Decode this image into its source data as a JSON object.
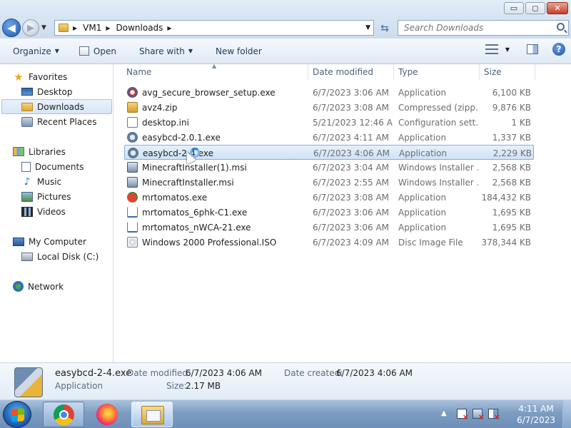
{
  "window": {
    "minimize": "▭",
    "maximize": "◻",
    "close": "✕"
  },
  "address": {
    "back": "◀",
    "forward": "▶",
    "crumbs": [
      "VM1",
      "Downloads"
    ],
    "refresh": "⇆",
    "search_placeholder": "Search Downloads"
  },
  "toolbar": {
    "organize": "Organize",
    "open": "Open",
    "share": "Share with",
    "new_folder": "New folder"
  },
  "nav": {
    "favorites": "Favorites",
    "desktop": "Desktop",
    "downloads": "Downloads",
    "recent": "Recent Places",
    "libraries": "Libraries",
    "documents": "Documents",
    "music": "Music",
    "pictures": "Pictures",
    "videos": "Videos",
    "computer": "My Computer",
    "local_disk": "Local Disk (C:)",
    "network": "Network"
  },
  "columns": {
    "name": "Name",
    "date": "Date modified",
    "type": "Type",
    "size": "Size"
  },
  "files": [
    {
      "icon": "avg-installer-icon",
      "name": "avg_secure_browser_setup.exe",
      "date": "6/7/2023 3:06 AM",
      "type": "Application",
      "size": "6,100 KB"
    },
    {
      "icon": "zip-icon",
      "name": "avz4.zip",
      "date": "6/7/2023 3:08 AM",
      "type": "Compressed (zipp...",
      "size": "9,876 KB"
    },
    {
      "icon": "ini-file-icon",
      "name": "desktop.ini",
      "date": "5/21/2023 12:46 AM",
      "type": "Configuration sett...",
      "size": "1 KB"
    },
    {
      "icon": "easybcd-icon",
      "name": "easybcd-2.0.1.exe",
      "date": "6/7/2023 4:11 AM",
      "type": "Application",
      "size": "1,337 KB"
    },
    {
      "icon": "easybcd-icon",
      "name": "easybcd-2-4.exe",
      "date": "6/7/2023 4:06 AM",
      "type": "Application",
      "size": "2,229 KB",
      "selected": true
    },
    {
      "icon": "msi-icon",
      "name": "MinecraftInstaller(1).msi",
      "date": "6/7/2023 3:04 AM",
      "type": "Windows Installer ...",
      "size": "2,568 KB"
    },
    {
      "icon": "msi-icon",
      "name": "MinecraftInstaller.msi",
      "date": "6/7/2023 2:55 AM",
      "type": "Windows Installer ...",
      "size": "2,568 KB"
    },
    {
      "icon": "tomato-icon",
      "name": "mrtomatos.exe",
      "date": "6/7/2023 3:08 AM",
      "type": "Application",
      "size": "184,432 KB"
    },
    {
      "icon": "download-file-icon",
      "name": "mrtomatos_6phk-C1.exe",
      "date": "6/7/2023 3:06 AM",
      "type": "Application",
      "size": "1,695 KB"
    },
    {
      "icon": "download-file-icon",
      "name": "mrtomatos_nWCA-21.exe",
      "date": "6/7/2023 3:06 AM",
      "type": "Application",
      "size": "1,695 KB"
    },
    {
      "icon": "disc-image-icon",
      "name": "Windows 2000 Professional.ISO",
      "date": "6/7/2023 4:09 AM",
      "type": "Disc Image File",
      "size": "378,344 KB"
    }
  ],
  "details": {
    "filename": "easybcd-2-4.exe",
    "kind": "Application",
    "modified_label": "Date modified:",
    "modified": "6/7/2023 4:06 AM",
    "created_label": "Date created:",
    "created": "6/7/2023 4:06 AM",
    "size_label": "Size:",
    "size": "2.17 MB"
  },
  "taskbar": {
    "time": "4:11 AM",
    "date": "6/7/2023",
    "tray_arrow": "▲"
  }
}
